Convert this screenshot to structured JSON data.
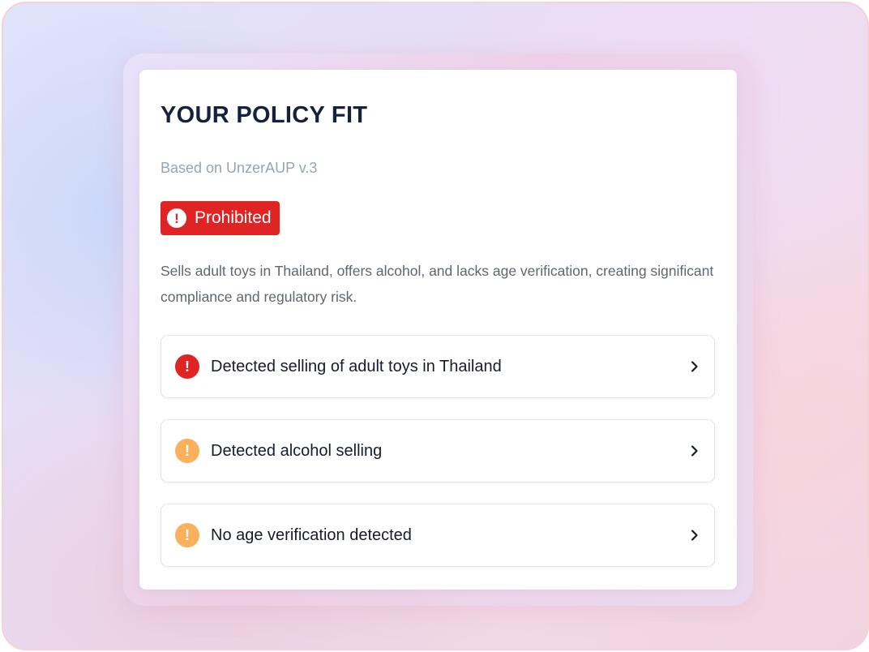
{
  "card": {
    "title": "YOUR POLICY FIT",
    "subtitle": "Based on UnzerAUP v.3",
    "status_badge": {
      "label": "Prohibited",
      "icon": "exclamation-circle-icon",
      "icon_glyph": "!",
      "color": "#e02424"
    },
    "description": "Sells adult toys in Thailand, offers alcohol, and lacks age verification, creating significant compliance and regulatory risk."
  },
  "findings": [
    {
      "label": "Detected selling of adult toys in Thailand",
      "severity": "critical",
      "icon": "exclamation-circle-icon",
      "icon_glyph": "!",
      "icon_color": "#e02424",
      "chevron": "chevron-right-icon"
    },
    {
      "label": "Detected alcohol selling",
      "severity": "warning",
      "icon": "exclamation-circle-icon",
      "icon_glyph": "!",
      "icon_color": "#fbb05c",
      "chevron": "chevron-right-icon"
    },
    {
      "label": "No age verification detected",
      "severity": "warning",
      "icon": "exclamation-circle-icon",
      "icon_glyph": "!",
      "icon_color": "#fbb05c",
      "chevron": "chevron-right-icon"
    }
  ]
}
